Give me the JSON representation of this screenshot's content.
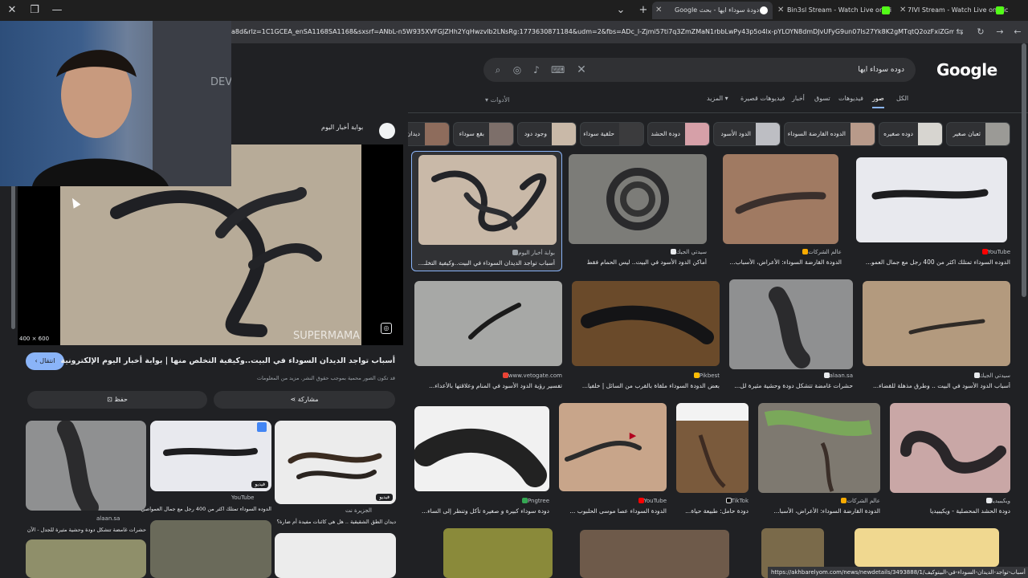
{
  "tabs": [
    {
      "title": "دودة سوداء ايها - بحث Google",
      "active": true,
      "favicon": "google-icon"
    },
    {
      "title": "Bin3sl Stream - Watch Live on Ki",
      "active": false,
      "favicon": "kick-icon"
    },
    {
      "title": "7IVI Stream - Watch Live on Kic",
      "active": false,
      "favicon": "kick-icon"
    }
  ],
  "address": {
    "url": "a8d&rlz=1C1GCEA_enSA1168SA1168&sxsrf=ANbL-n5W935XVFGJZHh2YqHwzvlb2LNsRg:1773630871184&udm=2&fbs=ADc_l-Zjmi57ti7q3ZmZMaN1rbbLwPy43p5o4lx-pYLOYN8dmDJvUFyG9un07Is27Yk8K2gMTqtQ2ozFxiZGm_iIFE"
  },
  "search": {
    "query": "دوده سوداء ايها"
  },
  "logo": "Google",
  "nav_tabs": [
    "الكل",
    "صور",
    "فيديوهات",
    "تسوق",
    "أخبار",
    "فيديوهات قصيرة",
    "المزيد"
  ],
  "tools_label": "الأدوات",
  "chips": [
    {
      "label": "ثعبان صغير"
    },
    {
      "label": "دوده صغيره"
    },
    {
      "label": "الدوده القارضة السوداء"
    },
    {
      "label": "الدود الأسود"
    },
    {
      "label": "دودة الحشد"
    },
    {
      "label": "حلقية سوداء"
    },
    {
      "label": "وجود دود"
    },
    {
      "label": "بقع سوداء"
    },
    {
      "label": "ديدان"
    }
  ],
  "results": [
    {
      "source": "بوابة أخبار اليوم",
      "title": "أسباب تواجد الديدان السوداء في البيت..وكيفية التخلـ..."
    },
    {
      "source": "سيدتي الجيك",
      "title": "أماكن الدود الأسود في البيت.. ليس الحمام فقط"
    },
    {
      "source": "عالم الشركات",
      "title": "الدودة القارضة السوداء: الأعراض، الأسباب..."
    },
    {
      "source": "YouTube",
      "title": "الدوده السوداء تمتلك اكثر من 400 رجل مع جمال العمو..."
    },
    {
      "source": "www.vetogate.com",
      "title": "تفسير رؤية الدود الأسود في المنام وعلاقتها بالأعداء..."
    },
    {
      "source": "Pikbest",
      "title": "بعض الدودة السوداء ملقاة بالقرب من السائل | خلفيا..."
    },
    {
      "source": "alaan.sa",
      "title": "حشرات غامضة تتشكل دودة وحشية مثيرة لل..."
    },
    {
      "source": "سيدتي الجيك",
      "title": "أسباب الدود الأسود في البيت .. وطرق مذهلة للقضاء..."
    },
    {
      "source": "Pngtree",
      "title": "دودة سوداء كبيرة و صغيرة تأكل وتنظر إلى الساء..."
    },
    {
      "source": "YouTube",
      "title": "الدودة السوداء عصا موسى الحلبوب ..."
    },
    {
      "source": "TikTok",
      "title": "دودة حامل: طبيعة حياة..."
    },
    {
      "source": "عالم الشركات",
      "title": "الدودة القارضة السوداء: الأعراض، الأسبا..."
    },
    {
      "source": "ويكيبيديا",
      "title": "دودة الحشد المحصلية - ويكيبيديا"
    }
  ],
  "panel": {
    "site": "بوابة أخبار اليوم",
    "dimensions": "400 × 600",
    "watermark": "SUPERMAMA",
    "title": "أسباب تواجد الديدان السوداء في البيت..وكيفية التخلص منها | بوابة أخبار اليوم الإلكترونية",
    "copyright": "قد تكون الصور محمية بموجب حقوق النشر. مزيد من المعلومات",
    "visit": "انتقال",
    "share": "مشاركة",
    "save": "حفظ",
    "related": [
      {
        "source": "alaan.sa",
        "text": "حشرات غامضة تتشكل دودة وحشية مثيرة للجدل - الآن"
      },
      {
        "source": "YouTube",
        "text": "الدوده السوداء تمتلك اكثر من 400 رجل مع جمال العمواصي"
      },
      {
        "source": "الجزيرة نت",
        "text": "ديدان الطق الشقيقية .. هل هي كائنات مفيدة أم ضارة؟"
      }
    ],
    "video_badge": "فيديو"
  },
  "overlay_badge": "DEV",
  "status_url": "https://akhbarelyom.com/news/newdetails/3493888/1/أسباب-تواجد-الديدان-السوداء-في-البيتوكيف"
}
